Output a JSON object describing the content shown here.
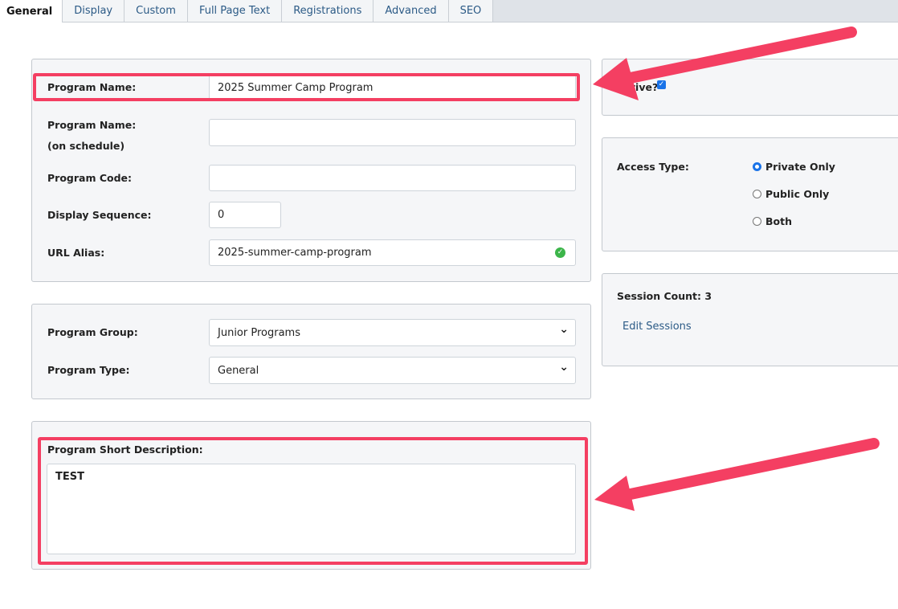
{
  "tabs": [
    "General",
    "Display",
    "Custom",
    "Full Page Text",
    "Registrations",
    "Advanced",
    "SEO"
  ],
  "active_tab": "General",
  "form": {
    "program_name_label": "Program Name:",
    "program_name_value": "2025 Summer Camp Program",
    "schedule_name_label": "Program Name:",
    "schedule_name_sub": "(on schedule)",
    "schedule_name_value": "",
    "code_label": "Program Code:",
    "code_value": "",
    "seq_label": "Display Sequence:",
    "seq_value": "0",
    "alias_label": "URL Alias:",
    "alias_value": "2025-summer-camp-program",
    "group_label": "Program Group:",
    "group_value": "Junior Programs",
    "type_label": "Program Type:",
    "type_value": "General",
    "desc_label": "Program Short Description:",
    "desc_value": "TEST"
  },
  "side": {
    "active_label": "Active?",
    "active_checked": true,
    "access_label": "Access Type:",
    "access_options": [
      "Private Only",
      "Public Only",
      "Both"
    ],
    "access_selected": "Private Only",
    "session_count_label": "Session Count: 3",
    "edit_sessions": "Edit Sessions"
  },
  "colors": {
    "highlight": "#f43f62",
    "link": "#2b5a86",
    "valid": "#3cb54a"
  }
}
